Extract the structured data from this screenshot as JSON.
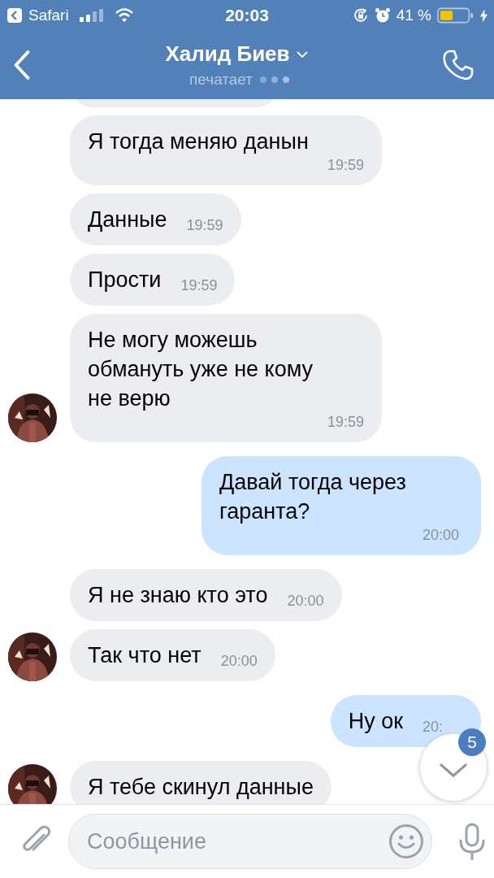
{
  "status_bar": {
    "back_app": "Safari",
    "time": "20:03",
    "battery": "41 %"
  },
  "header": {
    "title": "Халид Биев",
    "subtitle": "печатает"
  },
  "messages": [
    {
      "outgoing": false,
      "kind": "clipped",
      "avatar": false
    },
    {
      "outgoing": false,
      "kind": "text",
      "text": "Я тогда меняю данын",
      "time": "19:59",
      "avatar": false
    },
    {
      "outgoing": false,
      "kind": "text",
      "text": "Данные",
      "time": "19:59",
      "avatar": false
    },
    {
      "outgoing": false,
      "kind": "text",
      "text": "Прости",
      "time": "19:59",
      "avatar": false
    },
    {
      "outgoing": false,
      "kind": "text",
      "text": "Не могу можешь обмануть уже не кому не верю",
      "time": "19:59",
      "avatar": true
    },
    {
      "outgoing": true,
      "kind": "text",
      "text": "Давай тогда через гаранта?",
      "time": "20:00",
      "avatar": false
    },
    {
      "outgoing": false,
      "kind": "text",
      "text": "Я не знаю кто это",
      "time": "20:00",
      "avatar": false
    },
    {
      "outgoing": false,
      "kind": "text",
      "text": "Так что нет",
      "time": "20:00",
      "avatar": true
    },
    {
      "outgoing": true,
      "kind": "text",
      "text": "Ну ок",
      "time": "20:",
      "avatar": false
    },
    {
      "outgoing": false,
      "kind": "text",
      "text": "Я тебе скинул данные",
      "avatar": true
    }
  ],
  "scroll_down": {
    "badge": "5"
  },
  "composer": {
    "placeholder": "Сообщение"
  }
}
